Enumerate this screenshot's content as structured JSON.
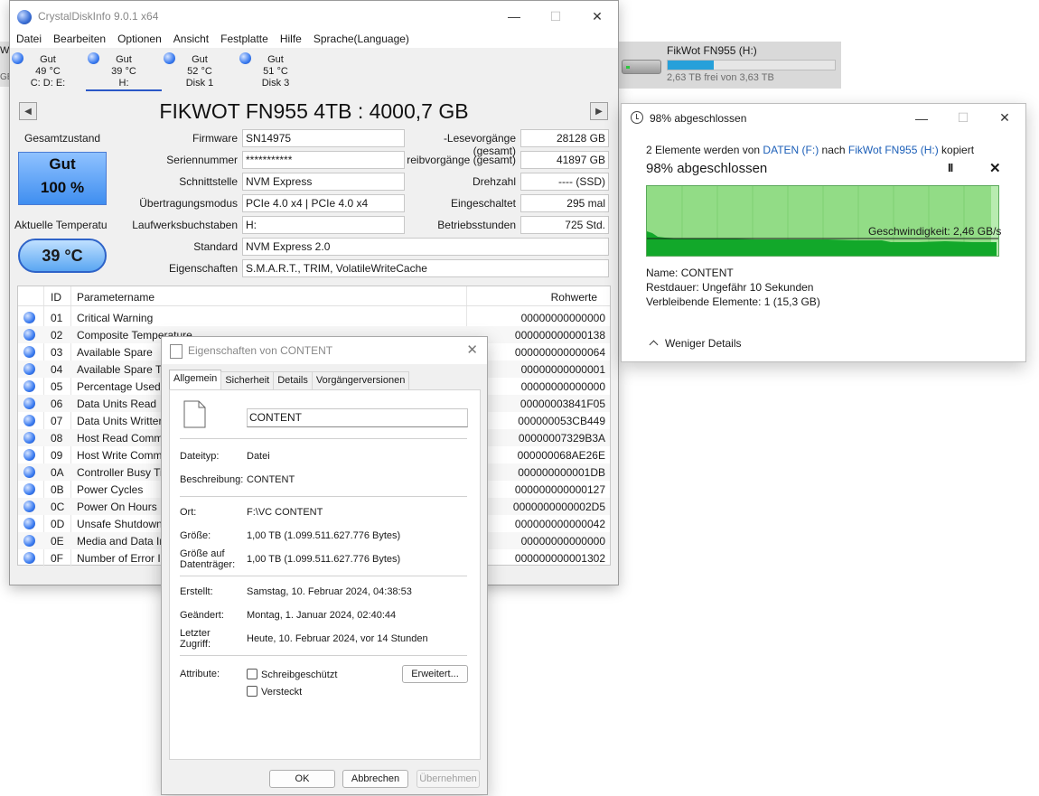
{
  "background": {
    "left_strip_w": "W",
    "left_strip_gb": "GB",
    "drive": {
      "name": "FikWot FN955 (H:)",
      "free_text": "2,63 TB frei von 3,63 TB",
      "used_fraction": 0.276
    }
  },
  "cdi": {
    "title": "CrystalDiskInfo 9.0.1 x64",
    "menu": [
      "Datei",
      "Bearbeiten",
      "Optionen",
      "Ansicht",
      "Festplatte",
      "Hilfe",
      "Sprache(Language)"
    ],
    "disks": [
      {
        "status": "Gut",
        "temp": "49 °C",
        "label": "C: D: E:"
      },
      {
        "status": "Gut",
        "temp": "39 °C",
        "label": "H:"
      },
      {
        "status": "Gut",
        "temp": "52 °C",
        "label": "Disk 1"
      },
      {
        "status": "Gut",
        "temp": "51 °C",
        "label": "Disk 3"
      }
    ],
    "model": "FIKWOT FN955 4TB : 4000,7 GB",
    "health_label": "Gesamtzustand",
    "health_status": "Gut",
    "health_pct": "100 %",
    "temp_label": "Aktuelle Temperatu",
    "temp_value": "39 °C",
    "fields": {
      "firmware_label": "Firmware",
      "firmware": "SN14975",
      "serial_label": "Seriennummer",
      "serial": "***********",
      "interface_label": "Schnittstelle",
      "interface": "NVM Express",
      "transfer_label": "Übertragungsmodus",
      "transfer": "PCIe 4.0 x4 | PCIe 4.0 x4",
      "letters_label": "Laufwerksbuchstaben",
      "letters": "H:",
      "standard_label": "Standard",
      "standard": "NVM Express 2.0",
      "features_label": "Eigenschaften",
      "features": "S.M.A.R.T., TRIM, VolatileWriteCache",
      "reads_label": "-Lesevorgänge (gesamt)",
      "reads": "28128 GB",
      "writes_label": "reibvorgänge (gesamt)",
      "writes": "41897 GB",
      "rpm_label": "Drehzahl",
      "rpm": "---- (SSD)",
      "poweron_count_label": "Eingeschaltet",
      "poweron_count": "295 mal",
      "poweron_hours_label": "Betriebsstunden",
      "poweron_hours": "725 Std."
    },
    "smart_headers": {
      "id": "ID",
      "name": "Parametername",
      "raw": "Rohwerte"
    },
    "smart_rows": [
      {
        "id": "01",
        "name": "Critical Warning",
        "raw": "00000000000000"
      },
      {
        "id": "02",
        "name": "Composite Temperature",
        "raw": "000000000000138"
      },
      {
        "id": "03",
        "name": "Available Spare",
        "raw": "000000000000064"
      },
      {
        "id": "04",
        "name": "Available Spare Th",
        "raw": "00000000000001"
      },
      {
        "id": "05",
        "name": "Percentage Used",
        "raw": "00000000000000"
      },
      {
        "id": "06",
        "name": "Data Units Read",
        "raw": "00000003841F05"
      },
      {
        "id": "07",
        "name": "Data Units Writter",
        "raw": "000000053CB449"
      },
      {
        "id": "08",
        "name": "Host Read Comma",
        "raw": "00000007329B3A"
      },
      {
        "id": "09",
        "name": "Host Write Comm",
        "raw": "000000068AE26E"
      },
      {
        "id": "0A",
        "name": "Controller Busy Tir",
        "raw": "000000000001DB"
      },
      {
        "id": "0B",
        "name": "Power Cycles",
        "raw": "000000000000127"
      },
      {
        "id": "0C",
        "name": "Power On Hours",
        "raw": "0000000000002D5"
      },
      {
        "id": "0D",
        "name": "Unsafe Shutdown",
        "raw": "000000000000042"
      },
      {
        "id": "0E",
        "name": "Media and Data In",
        "raw": "00000000000000"
      },
      {
        "id": "0F",
        "name": "Number of Error In",
        "raw": "000000000001302"
      }
    ]
  },
  "copy": {
    "title": "98% abgeschlossen",
    "desc_prefix": "2 Elemente werden von ",
    "source": "DATEN (F:)",
    "desc_mid": " nach ",
    "dest": "FikWot FN955 (H:)",
    "desc_suffix": " kopiert",
    "percent_text": "98% abgeschlossen",
    "percent_value": 0.98,
    "pause_symbol": "II",
    "cancel_symbol": "✕",
    "speed": "Geschwindigkeit: 2,46 GB/s",
    "name_label": "Name:",
    "name": "CONTENT",
    "remaining_label": "Restdauer:",
    "remaining": "Ungefähr 10 Sekunden",
    "items_label": "Verbleibende Elemente:",
    "items": "1 (15,3 GB)",
    "less_details": "Weniger Details"
  },
  "props": {
    "title": "Eigenschaften von CONTENT",
    "tabs": [
      "Allgemein",
      "Sicherheit",
      "Details",
      "Vorgängerversionen"
    ],
    "name": "CONTENT",
    "type_label": "Dateityp:",
    "type": "Datei",
    "desc_label": "Beschreibung:",
    "desc": "CONTENT",
    "location_label": "Ort:",
    "location": "F:\\VC CONTENT",
    "size_label": "Größe:",
    "size": "1,00 TB (1.099.511.627.776 Bytes)",
    "disk_size_label": "Größe auf Datenträger:",
    "disk_size": "1,00 TB (1.099.511.627.776 Bytes)",
    "created_label": "Erstellt:",
    "created": "Samstag, 10. Februar 2024, 04:38:53",
    "modified_label": "Geändert:",
    "modified": "Montag, 1. Januar 2024, 02:40:44",
    "accessed_label": "Letzter Zugriff:",
    "accessed": "Heute, 10. Februar 2024, vor 14 Stunden",
    "attr_label": "Attribute:",
    "readonly": "Schreibgeschützt",
    "hidden": "Versteckt",
    "advanced": "Erweitert...",
    "ok": "OK",
    "cancel": "Abbrechen",
    "apply": "Übernehmen"
  }
}
